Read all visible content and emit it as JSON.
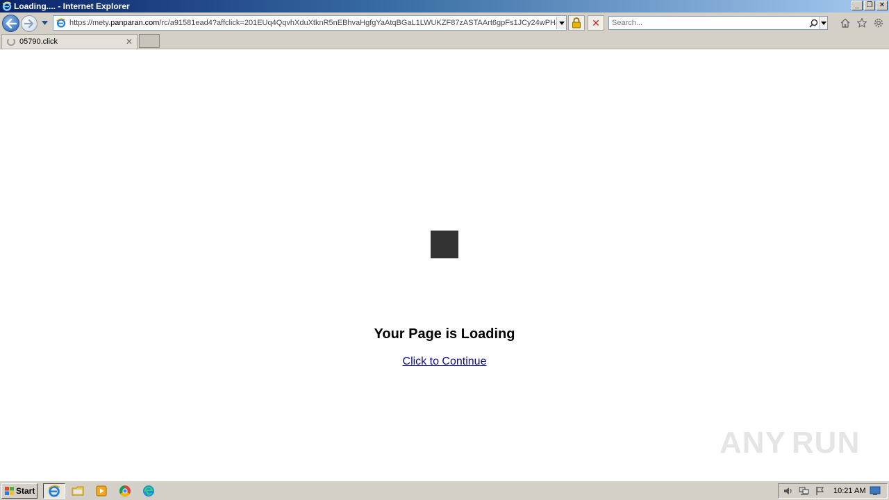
{
  "window": {
    "title": "Loading.... - Internet Explorer",
    "controls": {
      "minimize": "_",
      "restore": "❐",
      "close": "✕"
    }
  },
  "navbar": {
    "url_prefix": "https://mety.",
    "url_host": "panparan.com",
    "url_rest": "/rc/a91581ead4?affclick=201EUq4QqvhXduXtknR5nEBhvaHgfgYaAtqBGaL1LWUKZF87zASTAArt6gpFs1JCy24wPH&pu",
    "search_placeholder": "Search..."
  },
  "tabs": [
    {
      "label": "05790.click"
    }
  ],
  "page": {
    "heading": "Your Page is Loading",
    "link_text": "Click to Continue"
  },
  "watermark": {
    "left": "ANY",
    "right": "RUN"
  },
  "taskbar": {
    "start_label": "Start",
    "clock": "10:21 AM"
  },
  "colors": {
    "titlebar_start": "#0a246a",
    "loader": "#333333",
    "link": "#0b0b8a"
  }
}
